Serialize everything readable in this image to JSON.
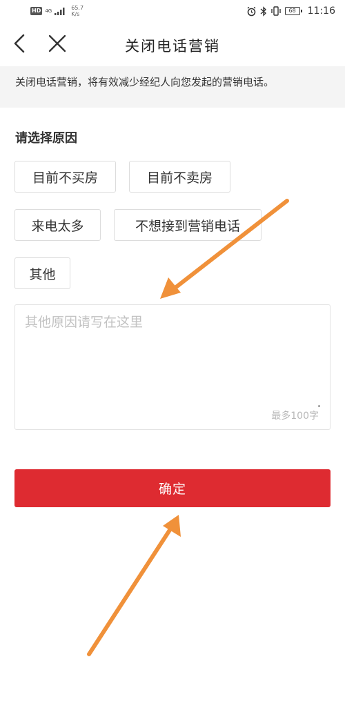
{
  "statusbar": {
    "hd": "HD",
    "net": "4G",
    "speed_value": "65.7",
    "speed_unit": "K/s",
    "battery": "68",
    "time": "11:16",
    "icons": [
      "alarm-icon",
      "bluetooth-icon",
      "vibrate-icon",
      "battery-icon"
    ]
  },
  "header": {
    "title": "关闭电话营销",
    "back_icon": "chevron-left-icon",
    "close_icon": "close-icon"
  },
  "notice": {
    "text": "关闭电话营销，将有效减少经纪人向您发起的营销电话。"
  },
  "reasons": {
    "title": "请选择原因",
    "options": [
      "目前不买房",
      "目前不卖房",
      "来电太多",
      "不想接到营销电话",
      "其他"
    ]
  },
  "other_reason": {
    "placeholder": "其他原因请写在这里",
    "counter": "最多100字"
  },
  "confirm": {
    "label": "确定"
  },
  "colors": {
    "accent": "#de2b31",
    "annotation_arrow": "#f0913a",
    "notice_bg": "#f4f4f4"
  }
}
